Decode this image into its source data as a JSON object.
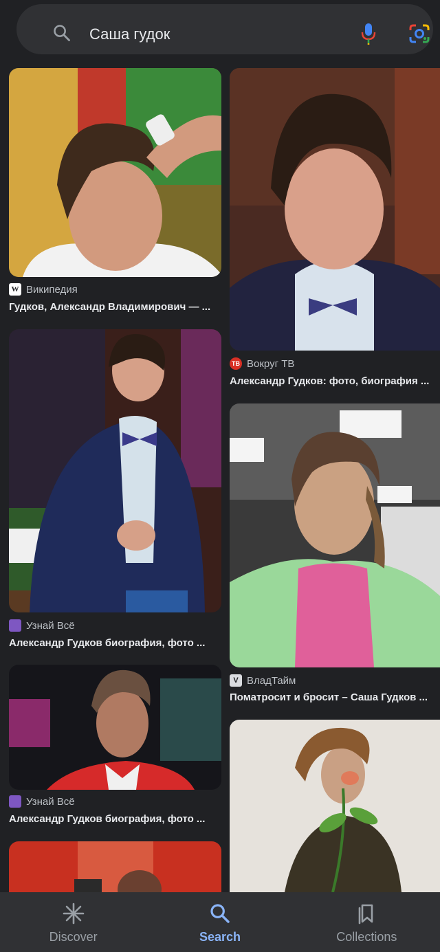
{
  "search": {
    "query": "Саша гудок"
  },
  "results": [
    {
      "source": "Википедия",
      "favicon": "W",
      "favicon_bg": "#ffffff",
      "favicon_fg": "#202124",
      "title": "Гудков, Александр Владимирович — ..."
    },
    {
      "source": "Вокруг ТВ",
      "favicon": "ТВ",
      "favicon_bg": "#d93025",
      "favicon_fg": "#ffffff",
      "title": "Александр Гудков: фото, биография ..."
    },
    {
      "source": "Узнай Всё",
      "favicon": "",
      "favicon_bg": "#7e57c2",
      "favicon_fg": "#ffffff",
      "title": "Александр Гудков биография, фото ..."
    },
    {
      "source": "ВладТайм",
      "favicon": "V",
      "favicon_bg": "#dadce0",
      "favicon_fg": "#202124",
      "title": "Поматросит и бросит – Саша Гудков ..."
    },
    {
      "source": "Узнай Всё",
      "favicon": "",
      "favicon_bg": "#7e57c2",
      "favicon_fg": "#ffffff",
      "title": "Александр Гудков биография, фото ..."
    }
  ],
  "nav": {
    "discover": "Discover",
    "search": "Search",
    "collections": "Collections"
  },
  "colors": {
    "accent": "#8ab4f8",
    "background": "#202124",
    "surface": "#303134"
  }
}
